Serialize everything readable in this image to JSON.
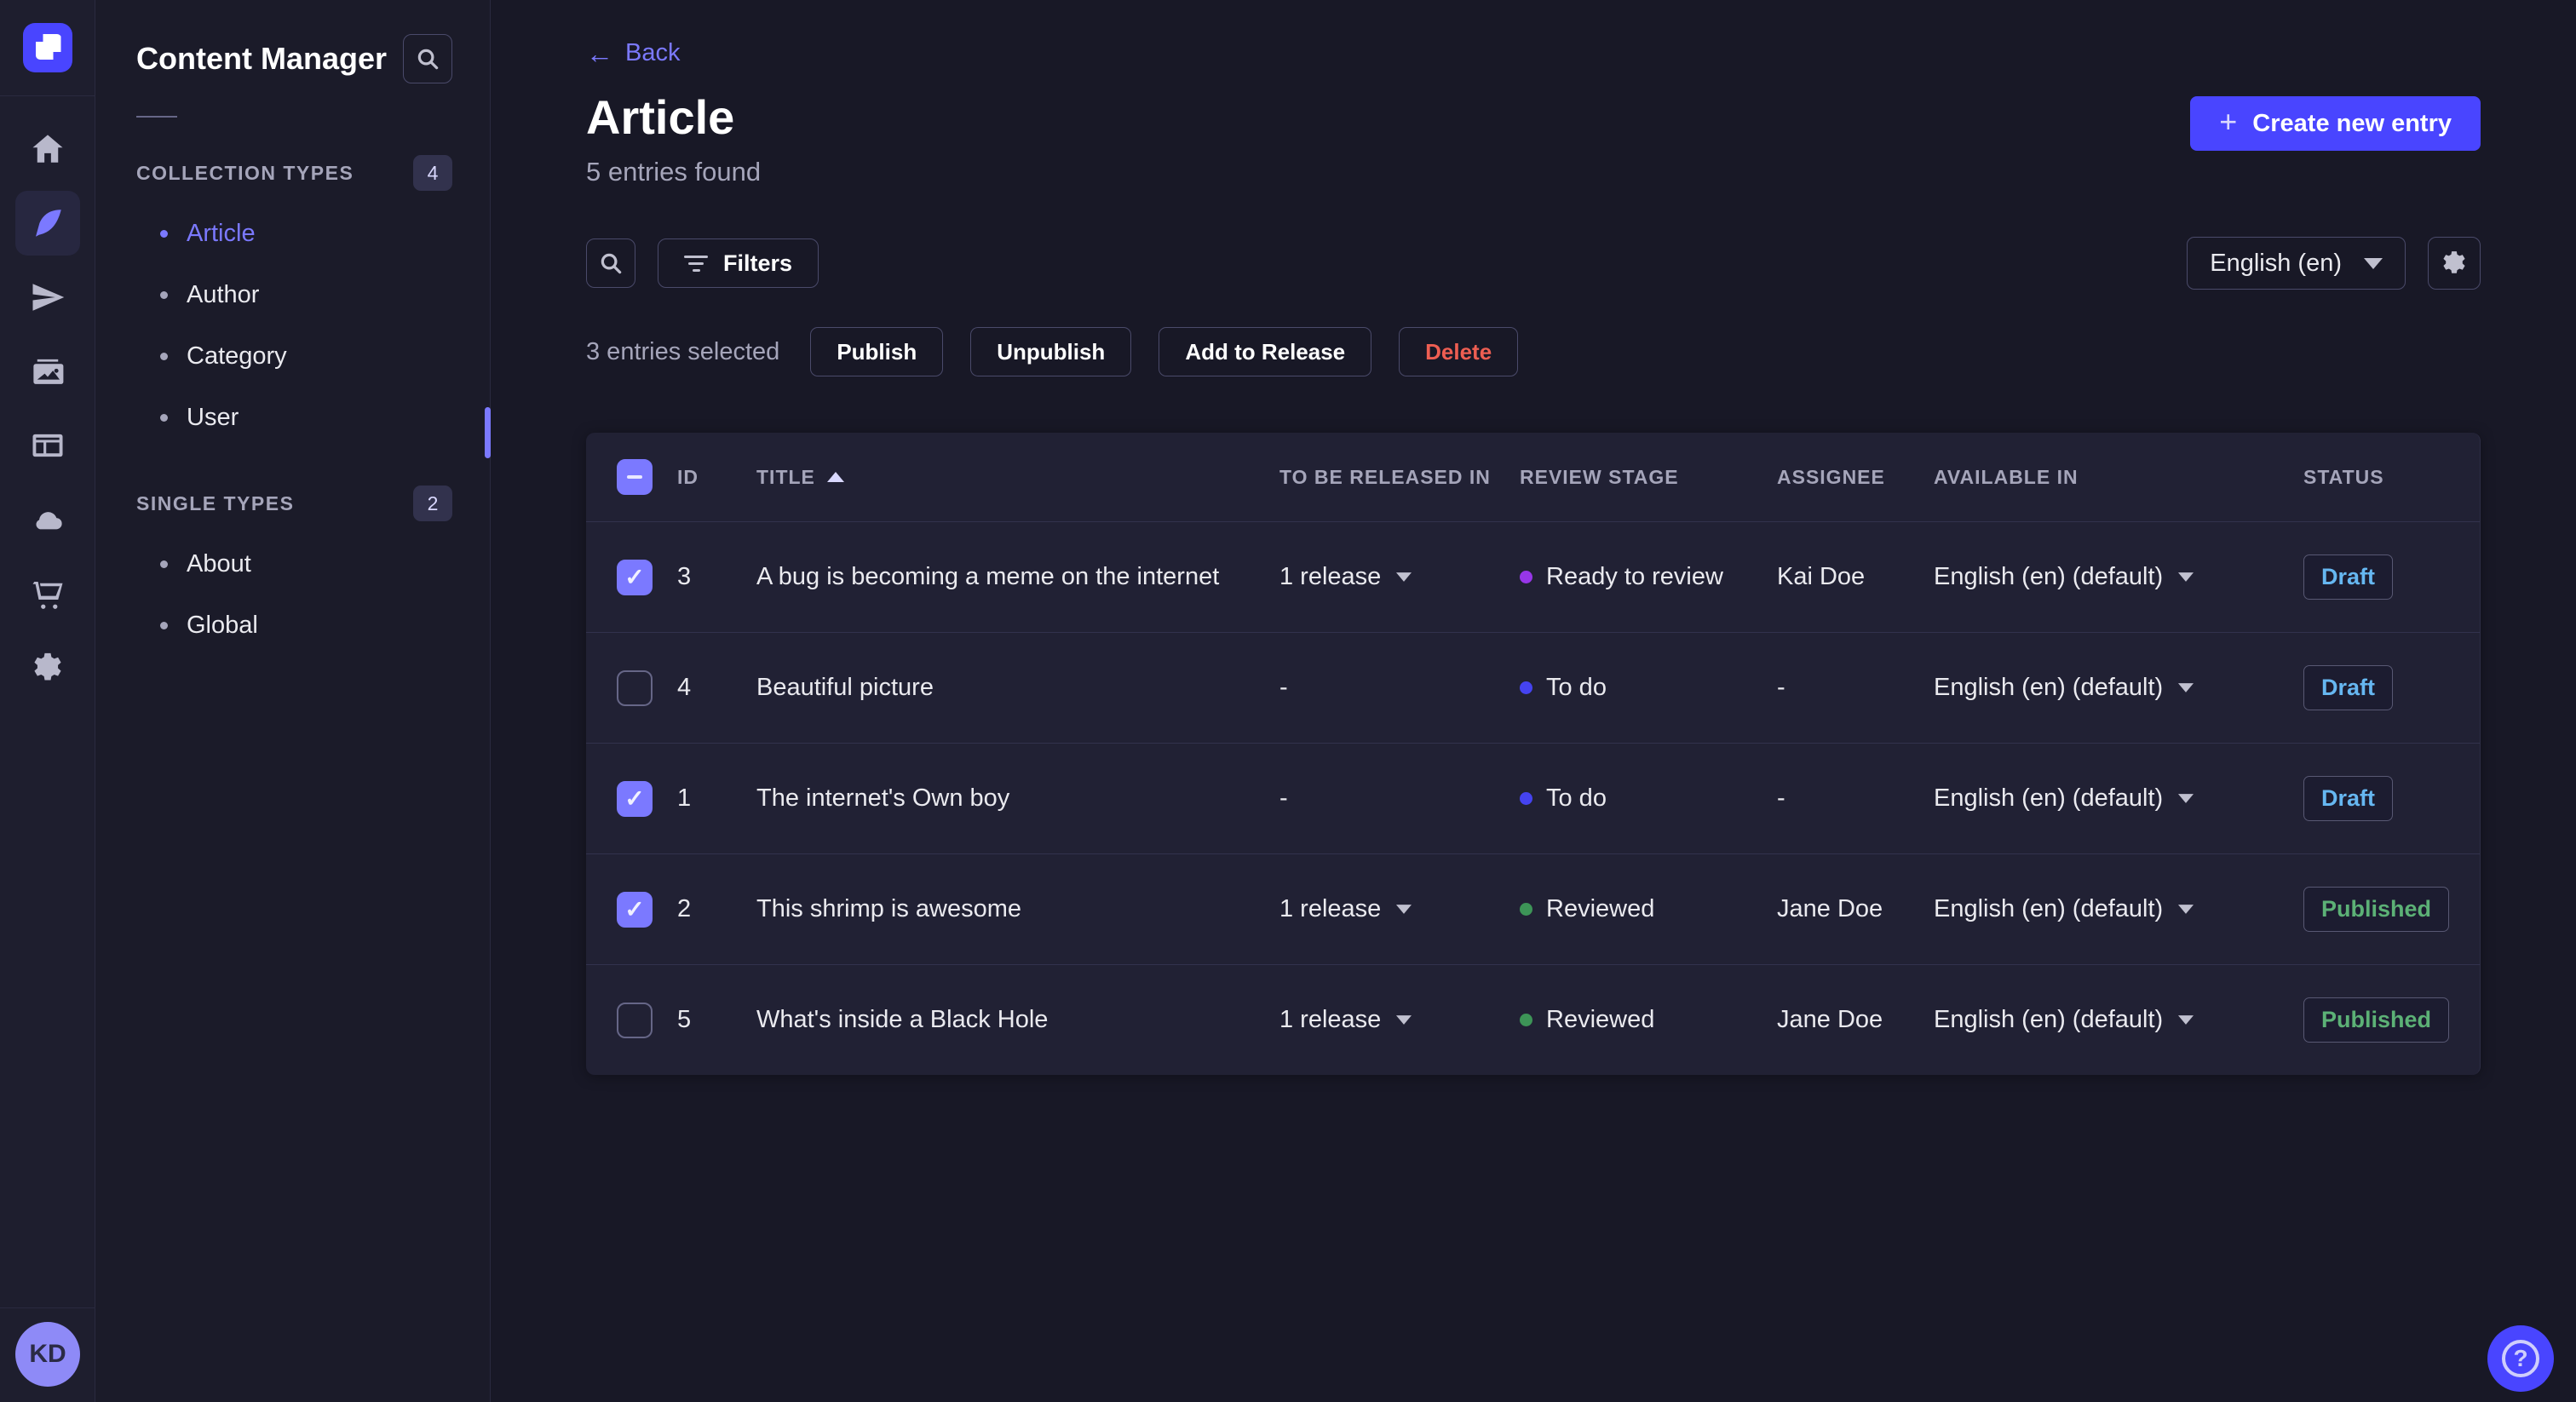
{
  "colors": {
    "accent": "#4945ff",
    "accent_light": "#7b79ff",
    "draft": "#66b7f1",
    "published": "#5cb176",
    "danger": "#ee5e52",
    "stage_ready": "#9736e8",
    "stage_todo": "#4945ff",
    "stage_reviewed": "#3d9457"
  },
  "rail": {
    "items": [
      {
        "name": "home"
      },
      {
        "name": "content-manager",
        "active": true
      },
      {
        "name": "releases"
      },
      {
        "name": "media-library"
      },
      {
        "name": "content-type-builder"
      },
      {
        "name": "deploy"
      },
      {
        "name": "marketplace"
      },
      {
        "name": "settings"
      }
    ],
    "user_initials": "KD"
  },
  "sidebar": {
    "title": "Content Manager",
    "sections": [
      {
        "label": "COLLECTION TYPES",
        "badge": "4",
        "items": [
          {
            "label": "Article",
            "active": true
          },
          {
            "label": "Author"
          },
          {
            "label": "Category"
          },
          {
            "label": "User"
          }
        ]
      },
      {
        "label": "SINGLE TYPES",
        "badge": "2",
        "items": [
          {
            "label": "About"
          },
          {
            "label": "Global"
          }
        ]
      }
    ]
  },
  "header": {
    "back_label": "Back",
    "back_arrow": "←",
    "title": "Article",
    "subtitle": "5 entries found",
    "create_button": "Create new entry",
    "create_plus": "+"
  },
  "toolbar": {
    "filters_label": "Filters",
    "locale_value": "English (en)"
  },
  "bulkbar": {
    "selected_text": "3 entries selected",
    "publish": "Publish",
    "unpublish": "Unpublish",
    "add_to_release": "Add to Release",
    "delete": "Delete"
  },
  "table": {
    "columns": [
      "ID",
      "TITLE",
      "TO BE RELEASED IN",
      "REVIEW STAGE",
      "ASSIGNEE",
      "AVAILABLE IN",
      "STATUS"
    ],
    "rows": [
      {
        "checked": true,
        "id": "3",
        "title": "A bug is becoming a meme on the internet",
        "release": "1 release",
        "has_release": true,
        "stage": "Ready to review",
        "stage_color": "#9736e8",
        "assignee": "Kai Doe",
        "locale": "English (en) (default)",
        "status": "Draft",
        "status_color": "#66b7f1"
      },
      {
        "checked": false,
        "id": "4",
        "title": "Beautiful picture",
        "release": "-",
        "has_release": false,
        "stage": "To do",
        "stage_color": "#4543f0",
        "assignee": "-",
        "locale": "English (en) (default)",
        "status": "Draft",
        "status_color": "#66b7f1"
      },
      {
        "checked": true,
        "id": "1",
        "title": "The internet's Own boy",
        "release": "-",
        "has_release": false,
        "stage": "To do",
        "stage_color": "#4543f0",
        "assignee": "-",
        "locale": "English (en) (default)",
        "status": "Draft",
        "status_color": "#66b7f1"
      },
      {
        "checked": true,
        "id": "2",
        "title": "This shrimp is awesome",
        "release": "1 release",
        "has_release": true,
        "stage": "Reviewed",
        "stage_color": "#3d9457",
        "assignee": "Jane Doe",
        "locale": "English (en) (default)",
        "status": "Published",
        "status_color": "#5cb176"
      },
      {
        "checked": false,
        "id": "5",
        "title": "What's inside a Black Hole",
        "release": "1 release",
        "has_release": true,
        "stage": "Reviewed",
        "stage_color": "#3d9457",
        "assignee": "Jane Doe",
        "locale": "English (en) (default)",
        "status": "Published",
        "status_color": "#5cb176"
      }
    ]
  }
}
